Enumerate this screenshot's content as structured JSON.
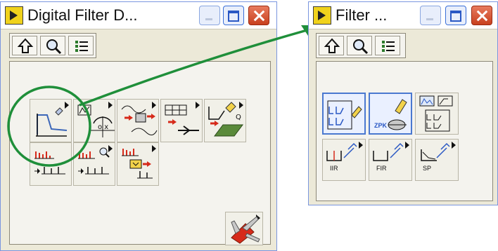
{
  "windows": {
    "main": {
      "title": "Digital Filter D..."
    },
    "sub": {
      "title": "Filter ..."
    }
  },
  "sub_palette": {
    "labels": {
      "iir": "IIR",
      "fir": "FIR",
      "sp": "SP",
      "zpk": "ZPK"
    }
  },
  "colors": {
    "highlight_ring": "#1f8f3a",
    "arrow": "#1f8f3a",
    "selected_border": "#4a78d0"
  }
}
